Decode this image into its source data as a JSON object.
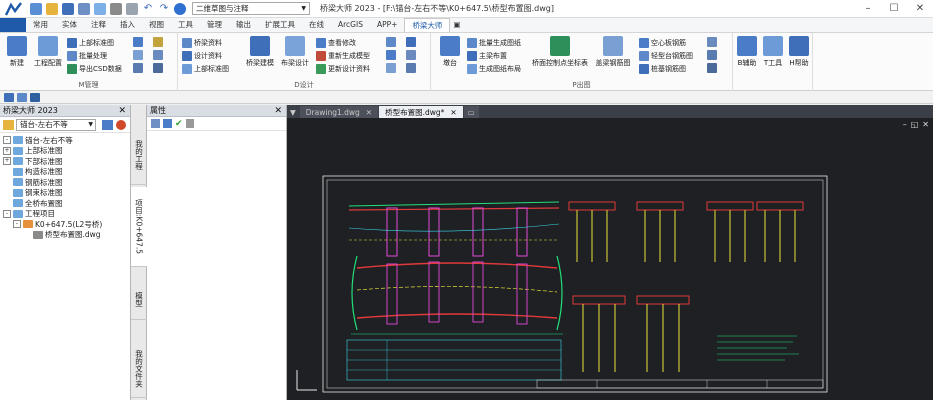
{
  "titlebar": {
    "workspace": "二维草图与注释",
    "title": "桥梁大师 2023 - [F:\\锚台-左右不等\\K0+647.5\\桥型布置图.dwg]"
  },
  "menu": [
    "常用",
    "实体",
    "注释",
    "插入",
    "视图",
    "工具",
    "管理",
    "输出",
    "扩展工具",
    "在线",
    "ArcGIS",
    "APP+",
    "桥梁大师"
  ],
  "menu_active": "桥梁大师",
  "ribbon": {
    "m_group": {
      "label": "M管理",
      "new": "新建",
      "config": "工程配置",
      "upper_std": "上部标准图",
      "batch": "批量处理",
      "export_csd": "导出CSD数据"
    },
    "d_group": {
      "label": "D设计",
      "bridge_data": "桥梁资料",
      "design_data": "设计资料",
      "upper_std2": "上部标准图",
      "bridge_model": "桥梁建模",
      "layout_design": "布梁设计",
      "view_modify": "查看修改",
      "regen_model": "重新生成模型",
      "update_data": "更新设计资料"
    },
    "p_group": {
      "label": "P出图",
      "abutment": "墩台",
      "batch_gen": "批量生成图纸",
      "main_beam": "主梁布置",
      "gen_layout": "生成图纸布局",
      "ctrl_pt": "桥面控制点坐标表",
      "upper_rebar": "盖梁钢筋图",
      "hollow_rebar": "空心板钢筋",
      "light_rebar": "轻型台钢筋图",
      "pile_rebar": "桩基钢筋图"
    },
    "tools": {
      "b": "B辅助",
      "t": "T工具",
      "h": "H帮助"
    }
  },
  "left_panel": {
    "title": "桥梁大师 2023",
    "project": "锚台-左右不等",
    "tree": [
      {
        "label": "锚台-左右不等",
        "level": 0,
        "toggle": "-"
      },
      {
        "label": "上部标准图",
        "level": 1,
        "toggle": "+"
      },
      {
        "label": "下部标准图",
        "level": 1,
        "toggle": "+"
      },
      {
        "label": "构造标准图",
        "level": 1,
        "toggle": ""
      },
      {
        "label": "钢筋标准图",
        "level": 1,
        "toggle": ""
      },
      {
        "label": "钢束标准图",
        "level": 1,
        "toggle": ""
      },
      {
        "label": "全桥布置图",
        "level": 1,
        "toggle": ""
      },
      {
        "label": "工程项目",
        "level": 0,
        "toggle": "-"
      },
      {
        "label": "K0+647.5(L2号桥)",
        "level": 1,
        "toggle": "-"
      },
      {
        "label": "桥型布置图.dwg",
        "level": 2,
        "toggle": ""
      }
    ]
  },
  "vtabs": [
    "我的工程",
    "项目:K0+647.5",
    "模型",
    "我的文件夹"
  ],
  "prop_panel": {
    "title": "属性"
  },
  "doc_tabs": [
    {
      "label": "Drawing1.dwg",
      "active": false
    },
    {
      "label": "桥型布置图.dwg*",
      "active": true
    }
  ],
  "colors": {
    "accent": "#1e5aa8",
    "canvas_bg": "#1e2024",
    "cad_green": "#22e07a",
    "cad_yellow": "#e8e03a",
    "cad_red": "#e23a3a",
    "cad_magenta": "#e24ad8",
    "cad_cyan": "#3ad8e8"
  }
}
